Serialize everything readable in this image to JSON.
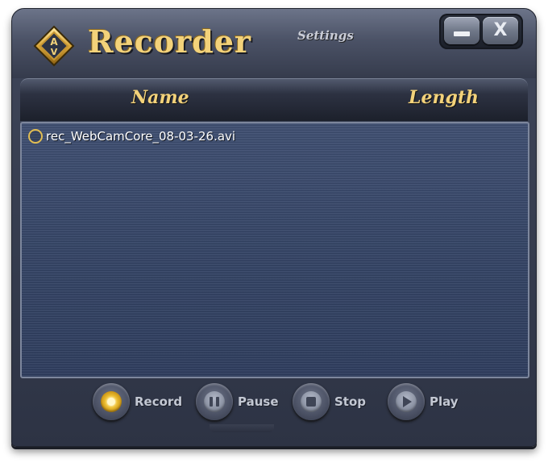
{
  "window": {
    "title": "Recorder",
    "settings_label": "Settings"
  },
  "window_buttons": {
    "minimize_icon": "minimize-icon",
    "close_label": "X"
  },
  "columns": {
    "name": "Name",
    "length": "Length"
  },
  "files": [
    {
      "name": "rec_WebCamCore_08-03-26.avi",
      "length": ""
    }
  ],
  "controls": {
    "record": "Record",
    "pause": "Pause",
    "stop": "Stop",
    "play": "Play"
  },
  "colors": {
    "accent_gold": "#f3d27a",
    "panel_blue": "#344466",
    "chrome": "#3d4457"
  }
}
